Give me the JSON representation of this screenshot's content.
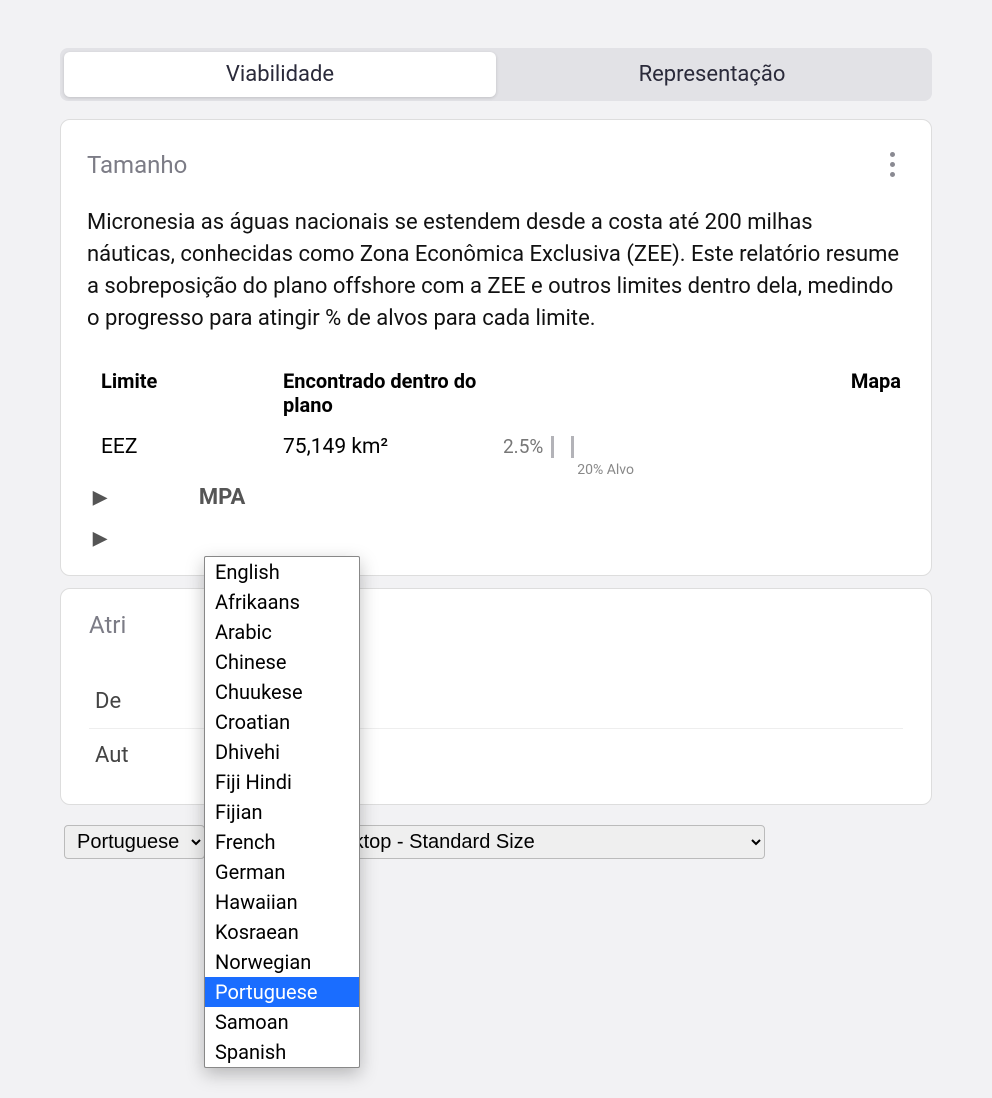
{
  "tabs": [
    {
      "label": "Viabilidade",
      "active": true
    },
    {
      "label": "Representação",
      "active": false
    }
  ],
  "size_card": {
    "title": "Tamanho",
    "description": "Micronesia as águas nacionais se estendem desde a costa até 200 milhas náuticas, conhecidas como Zona Econômica Exclusiva (ZEE). Este relatório resume a sobreposição do plano offshore com a ZEE e outros limites dentro dela, medindo o progresso para atingir % de alvos para cada limite.",
    "headers": {
      "boundary": "Limite",
      "found": "Encontrado dentro do plano",
      "map": "Mapa"
    },
    "row": {
      "boundary": "EEZ",
      "found": "75,149 km²",
      "percent": "2.5%",
      "target_label": "20% Alvo"
    },
    "expand_rows": [
      {
        "label": "MPA"
      },
      {
        "label": ""
      }
    ]
  },
  "attr_card": {
    "title": "Atri",
    "rows": [
      {
        "label_prefix": "De"
      },
      {
        "label_prefix": "Aut"
      }
    ]
  },
  "language_select": {
    "value": "Portuguese",
    "options": [
      "English",
      "Afrikaans",
      "Arabic",
      "Chinese",
      "Chuukese",
      "Croatian",
      "Dhivehi",
      "Fiji Hindi",
      "Fijian",
      "French",
      "German",
      "Hawaiian",
      "Kosraean",
      "Norwegian",
      "Portuguese",
      "Samoan",
      "Spanish"
    ]
  },
  "layout_select": {
    "value": "Desktop - Standard Size"
  }
}
